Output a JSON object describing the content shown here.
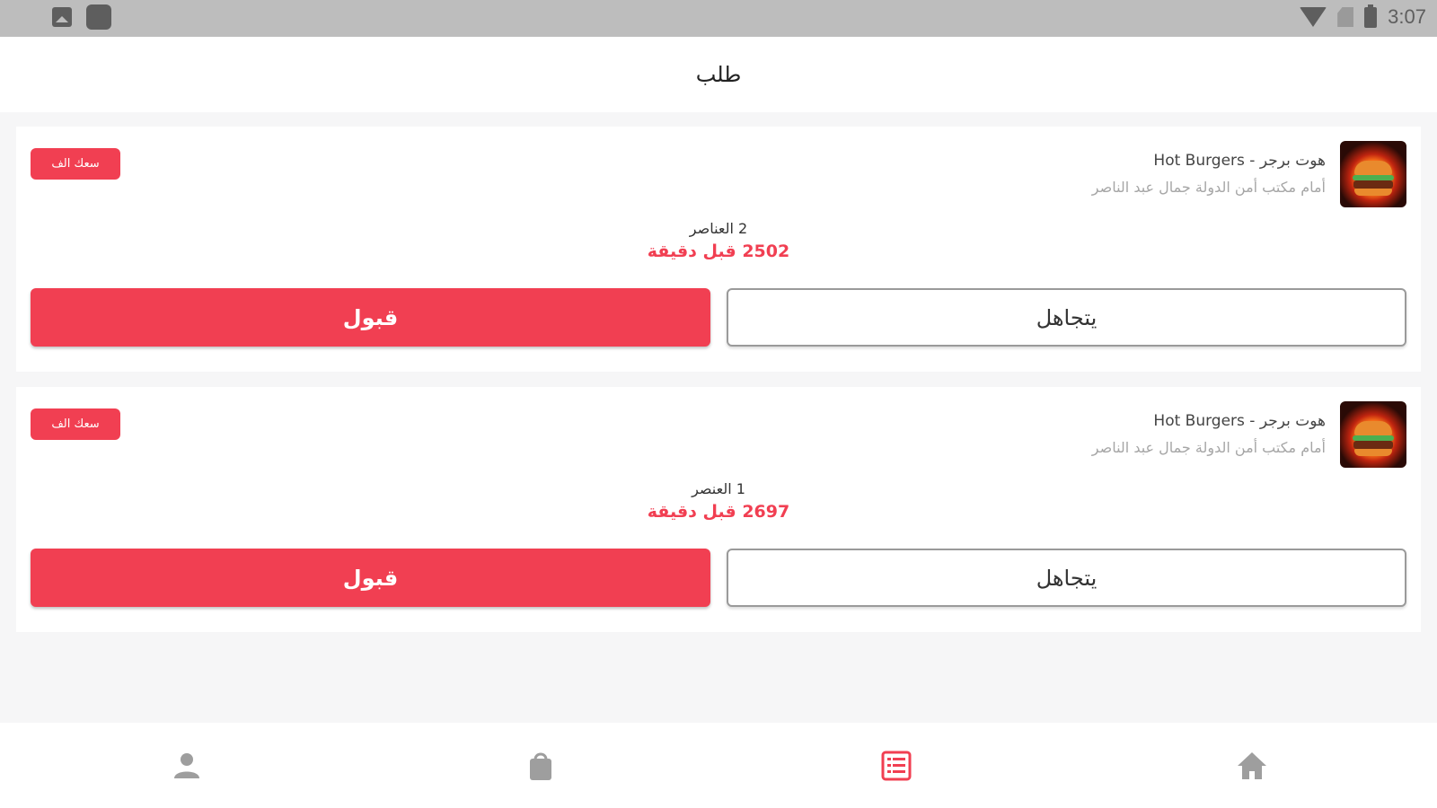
{
  "status_bar": {
    "time": "3:07",
    "icons": [
      "gallery-icon",
      "app-square-icon",
      "wifi-icon",
      "no-sim-icon",
      "battery-icon"
    ]
  },
  "app_bar": {
    "title": "طلب"
  },
  "orders": [
    {
      "store_name": "هوت برجر - Hot Burgers",
      "store_address": "أمام مكتب أمن الدولة جمال عبد الناصر",
      "badge": "سعك الف",
      "items": "2 العناصر",
      "time_ago": "2502 قبل دقيقة",
      "accept_label": "قبول",
      "ignore_label": "يتجاهل"
    },
    {
      "store_name": "هوت برجر - Hot Burgers",
      "store_address": "أمام مكتب أمن الدولة جمال عبد الناصر",
      "badge": "سعك الف",
      "items": "1 العنصر",
      "time_ago": "2697 قبل دقيقة",
      "accept_label": "قبول",
      "ignore_label": "يتجاهل"
    }
  ],
  "bottom_nav": {
    "items": [
      "profile-icon",
      "shopping-bag-icon",
      "orders-list-icon",
      "home-icon"
    ],
    "active": "orders-list-icon"
  },
  "colors": {
    "accent": "#f13f52",
    "status_bar": "#bdbdbd",
    "background": "#f6f6f7",
    "inactive_icon": "#9e9e9e"
  }
}
